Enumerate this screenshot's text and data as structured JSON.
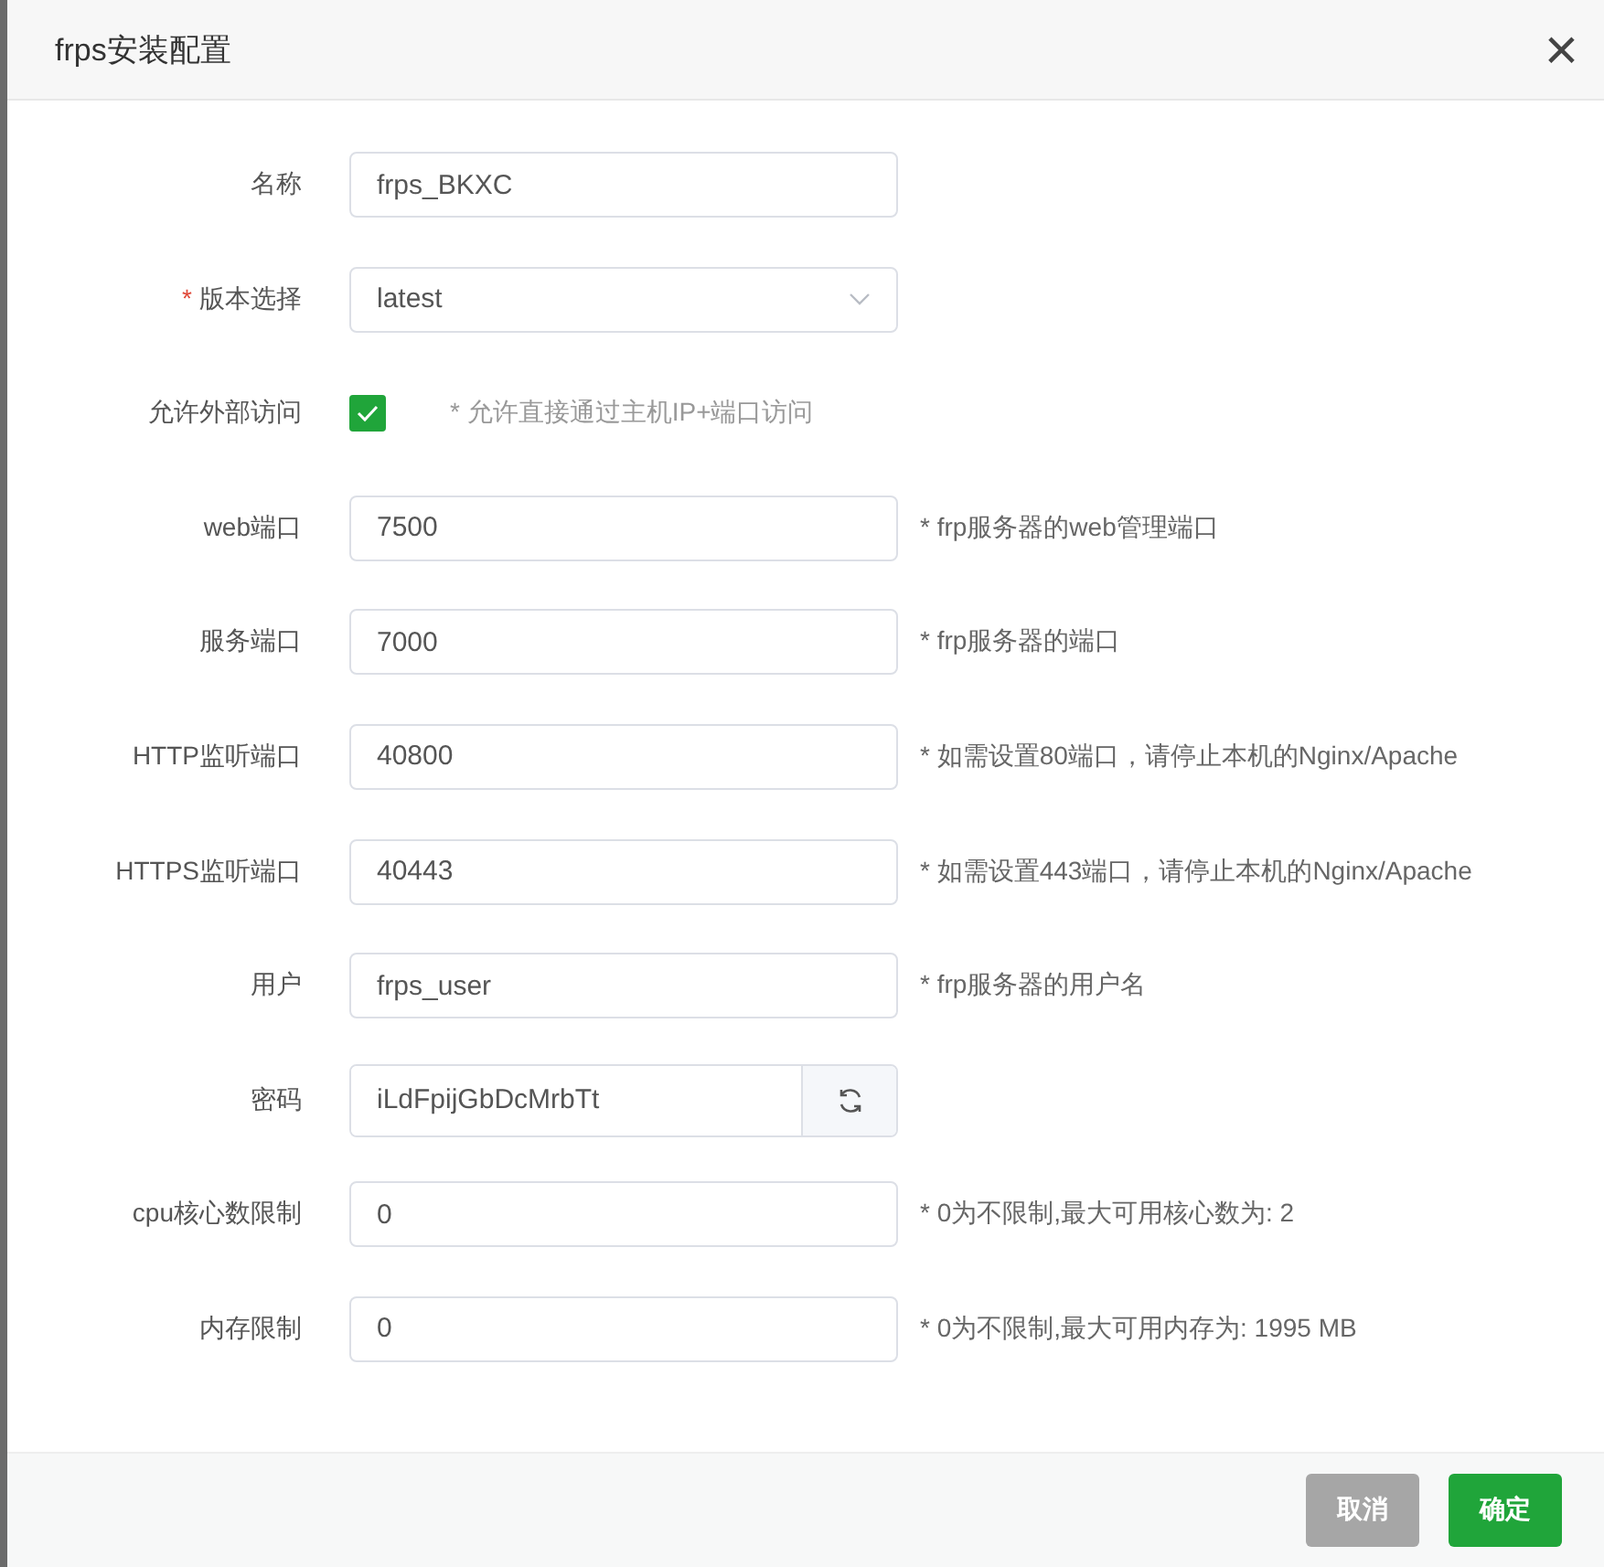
{
  "dialog": {
    "title": "frps安装配置",
    "close": "×"
  },
  "fields": [
    {
      "kind": "text",
      "label": "名称",
      "value": "frps_BKXC"
    },
    {
      "kind": "select",
      "label": "版本选择",
      "marker": "*",
      "value": "latest"
    },
    {
      "kind": "checkbox",
      "label": "允许外部访问",
      "checked": true,
      "hint": "* 允许直接通过主机IP+端口访问"
    },
    {
      "kind": "text",
      "label": "web端口",
      "value": "7500",
      "hint": "* frp服务器的web管理端口"
    },
    {
      "kind": "text",
      "label": "服务端口",
      "value": "7000",
      "hint": "* frp服务器的端口"
    },
    {
      "kind": "text",
      "label": "HTTP监听端口",
      "value": "40800",
      "hint": "* 如需设置80端口，请停止本机的Nginx/Apache"
    },
    {
      "kind": "text",
      "label": "HTTPS监听端口",
      "value": "40443",
      "hint": "* 如需设置443端口，请停止本机的Nginx/Apache"
    },
    {
      "kind": "text",
      "label": "用户",
      "value": "frps_user",
      "hint": "* frp服务器的用户名"
    },
    {
      "kind": "password",
      "label": "密码",
      "value": "iLdFpijGbDcMrbTt"
    },
    {
      "kind": "text",
      "label": "cpu核心数限制",
      "value": "0",
      "hint": "* 0为不限制,最大可用核心数为: 2"
    },
    {
      "kind": "text",
      "label": "内存限制",
      "value": "0",
      "hint": "* 0为不限制,最大可用内存为: 1995 MB"
    }
  ],
  "buttons": [
    {
      "label": "取消",
      "kind": "cancel",
      "disabled": true
    },
    {
      "label": "确定",
      "kind": "primary",
      "disabled": false
    }
  ]
}
